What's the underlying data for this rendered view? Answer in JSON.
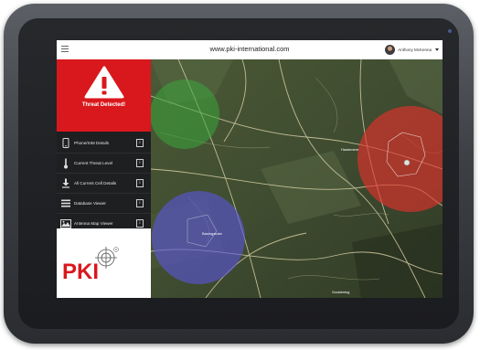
{
  "browser": {
    "url": "www.pki-international.com",
    "user_name": "Anthony McKenna",
    "menu_icon": "hamburger-icon",
    "dropdown_icon": "chevron-down-icon"
  },
  "alert": {
    "title": "Threat Detected!",
    "icon": "warning-triangle-icon",
    "color": "#d9181d"
  },
  "sidebar": {
    "items": [
      {
        "label": "Phone/SIM Details",
        "icon": "phone-icon"
      },
      {
        "label": "Current Threat Level",
        "icon": "thermometer-icon"
      },
      {
        "label": "All Current Cell Details",
        "icon": "download-icon"
      },
      {
        "label": "Database Viewer",
        "icon": "list-icon"
      },
      {
        "label": "Antenna Map Viewer",
        "icon": "map-icon"
      }
    ],
    "info_label": "i"
  },
  "logo": {
    "text": "PKI",
    "color": "#d9181d"
  },
  "map": {
    "zones": [
      {
        "name": "green-zone",
        "color": "#3aa63a"
      },
      {
        "name": "red-zone",
        "color": "#e8312b"
      },
      {
        "name": "blue-zone",
        "color": "#5a55d8"
      }
    ],
    "place_labels": [
      "Basingstoke",
      "Haslemere",
      "Godalming"
    ]
  }
}
